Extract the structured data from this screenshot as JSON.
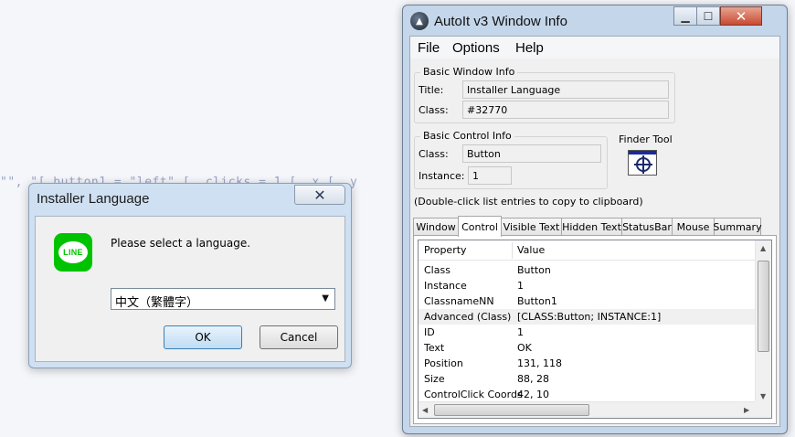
{
  "background_code": "\"\", \"[ button1 = \"left\" [, clicks = 1 [, x [, y",
  "installer": {
    "title": "Installer Language",
    "close_glyph": "✕",
    "message": "Please select a language.",
    "selected_language": "中文（繁體字）",
    "ok_label": "OK",
    "cancel_label": "Cancel",
    "logo_text": "LINE"
  },
  "autoit": {
    "title": "AutoIt v3 Window Info",
    "menu": [
      "File",
      "Options",
      "Help"
    ],
    "basic_window": {
      "label": "Basic Window Info",
      "title_label": "Title:",
      "title_value": "Installer Language",
      "class_label": "Class:",
      "class_value": "#32770"
    },
    "basic_control": {
      "label": "Basic Control Info",
      "class_label": "Class:",
      "class_value": "Button",
      "instance_label": "Instance:",
      "instance_value": "1"
    },
    "finder_tool_label": "Finder Tool",
    "hint": "(Double-click list entries to copy to clipboard)",
    "tabs": [
      "Window",
      "Control",
      "Visible Text",
      "Hidden Text",
      "StatusBar",
      "Mouse",
      "Summary"
    ],
    "active_tab": "Control",
    "columns": [
      "Property",
      "Value"
    ],
    "rows": [
      {
        "property": "Class",
        "value": "Button"
      },
      {
        "property": "Instance",
        "value": "1"
      },
      {
        "property": "ClassnameNN",
        "value": "Button1"
      },
      {
        "property": "Advanced (Class)",
        "value": "[CLASS:Button; INSTANCE:1]"
      },
      {
        "property": "ID",
        "value": "1"
      },
      {
        "property": "Text",
        "value": "OK"
      },
      {
        "property": "Position",
        "value": "131, 118"
      },
      {
        "property": "Size",
        "value": "88, 28"
      },
      {
        "property": "ControlClick Coords",
        "value": "42, 10"
      }
    ],
    "highlighted_row": 3,
    "colors": {
      "accent_close": "#c94a32",
      "line_green": "#00c300"
    }
  }
}
